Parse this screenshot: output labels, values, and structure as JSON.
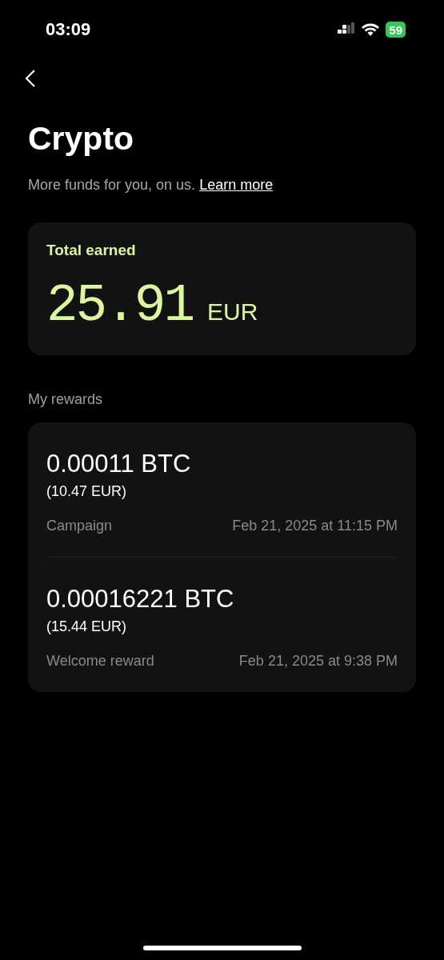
{
  "status_bar": {
    "time": "03:09",
    "battery": "59"
  },
  "header": {
    "title": "Crypto",
    "subtitle": "More funds for you, on us.",
    "link": "Learn more"
  },
  "total": {
    "label": "Total earned",
    "amount": "25.91",
    "currency": "EUR"
  },
  "rewards": {
    "heading": "My rewards",
    "items": [
      {
        "amount": "0.00011 BTC",
        "fiat": "(10.47 EUR)",
        "source": "Campaign",
        "date": "Feb 21, 2025 at 11:15 PM"
      },
      {
        "amount": "0.00016221 BTC",
        "fiat": "(15.44 EUR)",
        "source": "Welcome reward",
        "date": "Feb 21, 2025 at 9:38 PM"
      }
    ]
  }
}
